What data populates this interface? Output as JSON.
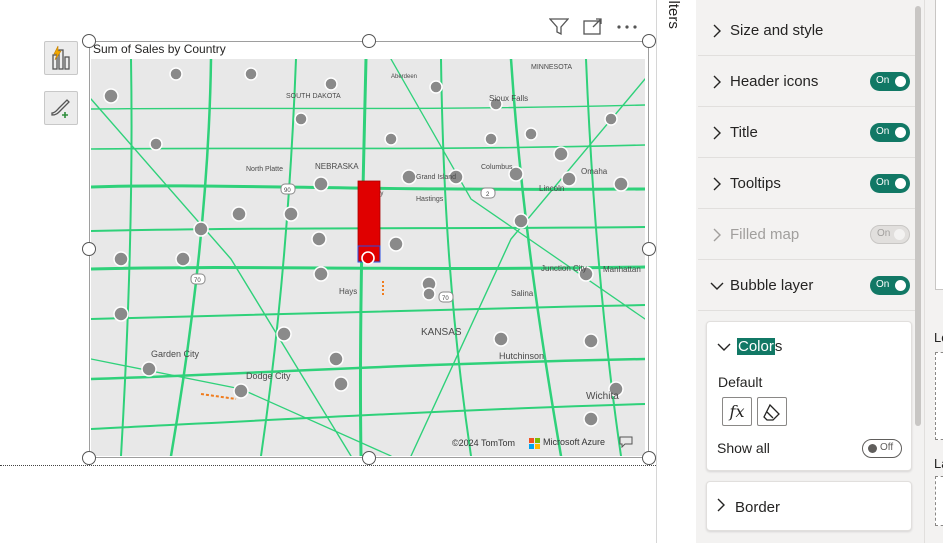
{
  "visual": {
    "title": "Sum of Sales by Country",
    "attribution": "©2024 TomTom",
    "provider": "Microsoft Azure",
    "header_icons": [
      "filter-icon",
      "focus-mode-icon",
      "more-options-icon"
    ],
    "side_tools": [
      "quick-insights-icon",
      "format-painter-icon"
    ],
    "map_labels": [
      {
        "text": "MINNESOTA"
      },
      {
        "text": "Aberdeen"
      },
      {
        "text": "SOUTH DAKOTA"
      },
      {
        "text": "Sioux Falls"
      },
      {
        "text": "NEBRASKA"
      },
      {
        "text": "North Platte"
      },
      {
        "text": "Kearney"
      },
      {
        "text": "Grand Island"
      },
      {
        "text": "Hastings"
      },
      {
        "text": "Columbus"
      },
      {
        "text": "Lincoln"
      },
      {
        "text": "Omaha"
      },
      {
        "text": "Hays"
      },
      {
        "text": "Salina"
      },
      {
        "text": "Junction City"
      },
      {
        "text": "Manhattan"
      },
      {
        "text": "KANSAS"
      },
      {
        "text": "Hutchinson"
      },
      {
        "text": "Garden City"
      },
      {
        "text": "Dodge City"
      },
      {
        "text": "Wichita"
      }
    ],
    "highway_shields": [
      "90",
      "70",
      "70",
      "2"
    ]
  },
  "filters_strip": {
    "label": "Filters"
  },
  "format_pane": {
    "rows": [
      {
        "label": "Size and style",
        "toggle": null
      },
      {
        "label": "Header icons",
        "toggle": "On"
      },
      {
        "label": "Title",
        "toggle": "On"
      },
      {
        "label": "Tooltips",
        "toggle": "On"
      },
      {
        "label": "Filled map",
        "toggle": "On",
        "disabled": true
      },
      {
        "label": "Bubble layer",
        "toggle": "On",
        "expanded": true
      }
    ],
    "colors_card": {
      "title_highlight": "Color",
      "title_rest": "s",
      "default_label": "Default",
      "fx_label": "fx",
      "show_all_label": "Show all",
      "show_all_toggle": "Off"
    },
    "border_row": {
      "label": "Border"
    }
  },
  "right_panel": {
    "texts": [
      "Lo",
      "La"
    ]
  },
  "colors": {
    "accent": "#117865",
    "bubble": "#e00000",
    "roads": "#2fd17a",
    "map_bg": "#e8e8e8"
  }
}
